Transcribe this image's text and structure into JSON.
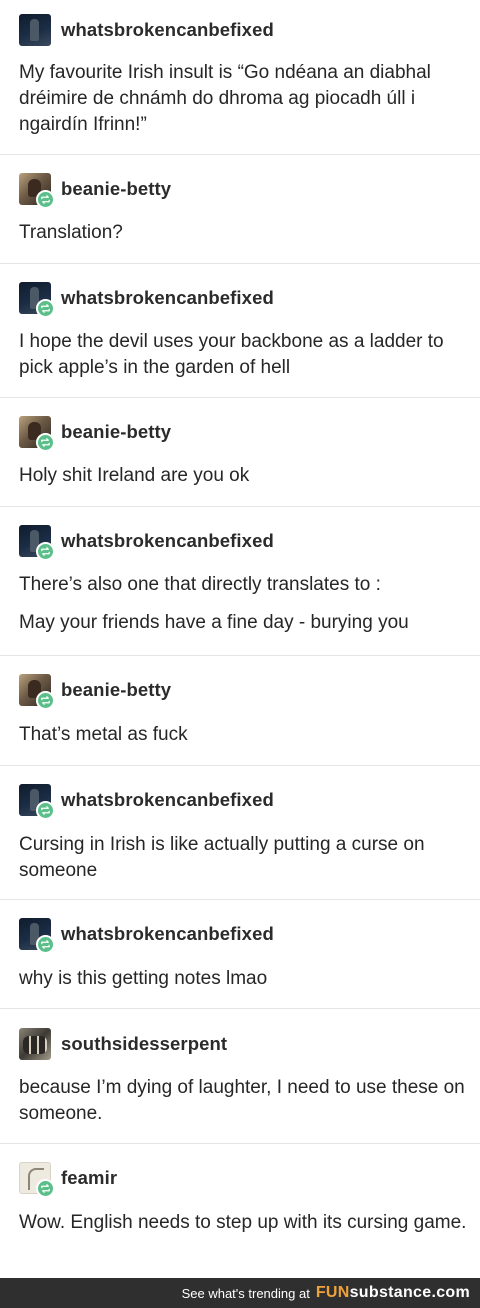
{
  "posts": [
    {
      "username": "whatsbrokencanbefixed",
      "avatar": "dark",
      "reblog": false,
      "paragraphs": [
        "My favourite Irish insult is “Go ndéana an diabhal dréimire de chnámh do dhroma ag piocadh úll i ngairdín Ifrinn!”"
      ]
    },
    {
      "username": "beanie-betty",
      "avatar": "photo",
      "reblog": true,
      "paragraphs": [
        "Translation?"
      ]
    },
    {
      "username": "whatsbrokencanbefixed",
      "avatar": "dark",
      "reblog": true,
      "paragraphs": [
        "I hope the devil uses your backbone as a ladder to pick apple’s in the garden of hell"
      ]
    },
    {
      "username": "beanie-betty",
      "avatar": "photo",
      "reblog": true,
      "paragraphs": [
        "Holy shit Ireland are you ok"
      ]
    },
    {
      "username": "whatsbrokencanbefixed",
      "avatar": "dark",
      "reblog": true,
      "paragraphs": [
        "There’s also one that directly translates to :",
        "May your friends have a fine day - burying you"
      ]
    },
    {
      "username": "beanie-betty",
      "avatar": "photo",
      "reblog": true,
      "paragraphs": [
        "That’s metal as fuck"
      ]
    },
    {
      "username": "whatsbrokencanbefixed",
      "avatar": "dark",
      "reblog": true,
      "paragraphs": [
        "Cursing in Irish is like actually putting a curse on someone"
      ]
    },
    {
      "username": "whatsbrokencanbefixed",
      "avatar": "dark",
      "reblog": true,
      "paragraphs": [
        "why is this getting notes lmao"
      ]
    },
    {
      "username": "southsidesserpent",
      "avatar": "group",
      "reblog": false,
      "paragraphs": [
        "because I’m dying of laughter, I need to use these on someone."
      ]
    },
    {
      "username": "feamir",
      "avatar": "sketch",
      "reblog": true,
      "paragraphs": [
        "Wow. English needs to step up with its cursing game."
      ]
    }
  ],
  "footer": {
    "trending_text": "See what's trending at",
    "brand_fun": "FUN",
    "brand_rest": "substance.com"
  },
  "colors": {
    "reblog_badge": "#5bbf8a",
    "footer_bg": "#2f2f2f",
    "brand_accent": "#f0a23a"
  },
  "icons": {
    "reblog": "reblog-icon"
  }
}
